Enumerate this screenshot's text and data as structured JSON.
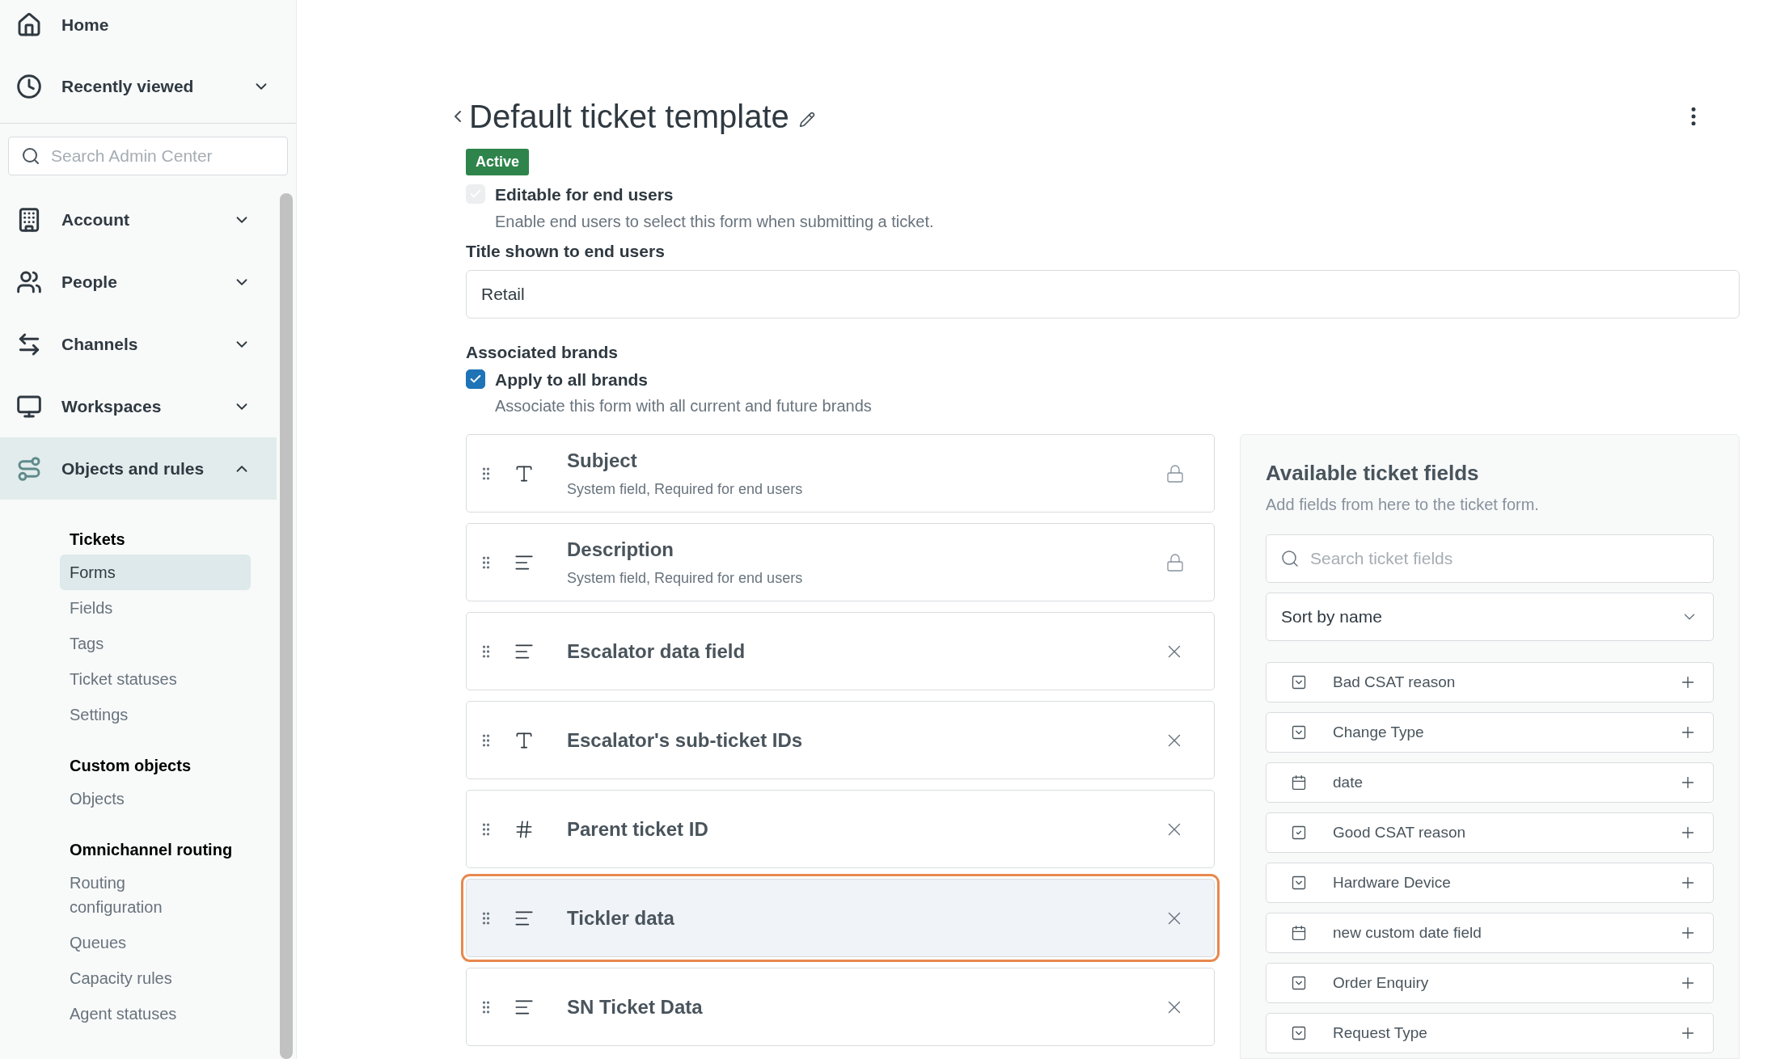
{
  "sidebar": {
    "top_items": [
      {
        "label": "Home",
        "selected": false
      },
      {
        "label": "Recently viewed",
        "selected": false,
        "expanded": false
      }
    ],
    "search": {
      "placeholder": "Search Admin Center"
    },
    "items": [
      {
        "label": "Account",
        "selected": false,
        "expanded": false
      },
      {
        "label": "People",
        "selected": false,
        "expanded": false
      },
      {
        "label": "Channels",
        "selected": false,
        "expanded": false
      },
      {
        "label": "Workspaces",
        "selected": false,
        "expanded": false
      },
      {
        "label": "Objects and rules",
        "selected": true,
        "expanded": true
      }
    ],
    "sections": [
      {
        "heading": "Tickets",
        "links": [
          {
            "label": "Forms",
            "selected": true
          },
          {
            "label": "Fields",
            "selected": false
          },
          {
            "label": "Tags",
            "selected": false
          },
          {
            "label": "Ticket statuses",
            "selected": false
          },
          {
            "label": "Settings",
            "selected": false
          }
        ]
      },
      {
        "heading": "Custom objects",
        "links": [
          {
            "label": "Objects",
            "selected": false
          }
        ]
      },
      {
        "heading": "Omnichannel routing",
        "links": [
          {
            "label": "Routing configuration",
            "selected": false
          },
          {
            "label": "Queues",
            "selected": false
          },
          {
            "label": "Capacity rules",
            "selected": false
          },
          {
            "label": "Agent statuses",
            "selected": false
          }
        ]
      }
    ]
  },
  "header": {
    "title": "Default ticket template",
    "status": "Active"
  },
  "editable": {
    "label": "Editable for end users",
    "hint": "Enable end users to select this form when submitting a ticket.",
    "checked": true,
    "disabled": true
  },
  "title_field": {
    "label": "Title shown to end users",
    "value": "Retail"
  },
  "brands": {
    "heading": "Associated brands",
    "label": "Apply to all brands",
    "hint": "Associate this form with all current and future brands",
    "checked": true,
    "disabled": false
  },
  "form_fields": [
    {
      "name": "Subject",
      "kind": "text",
      "detail": "System field, Required for end users",
      "locked": true,
      "highlighted": false
    },
    {
      "name": "Description",
      "kind": "multiline",
      "detail": "System field, Required for end users",
      "locked": true,
      "highlighted": false
    },
    {
      "name": "Escalator data field",
      "kind": "multiline",
      "locked": false,
      "highlighted": false
    },
    {
      "name": "Escalator's sub-ticket IDs",
      "kind": "text",
      "locked": false,
      "highlighted": false
    },
    {
      "name": "Parent ticket ID",
      "kind": "number",
      "locked": false,
      "highlighted": false
    },
    {
      "name": "Tickler data",
      "kind": "multiline",
      "locked": false,
      "highlighted": true
    },
    {
      "name": "SN Ticket Data",
      "kind": "multiline",
      "locked": false,
      "highlighted": false
    }
  ],
  "available": {
    "title": "Available ticket fields",
    "subtitle": "Add fields from here to the ticket form.",
    "search_placeholder": "Search ticket fields",
    "sort": "Sort by name",
    "fields": [
      {
        "name": "Bad CSAT reason",
        "kind": "dropdown"
      },
      {
        "name": "Change Type",
        "kind": "dropdown"
      },
      {
        "name": "date",
        "kind": "date"
      },
      {
        "name": "Good CSAT reason",
        "kind": "multiselect"
      },
      {
        "name": "Hardware Device",
        "kind": "dropdown"
      },
      {
        "name": "new custom date field",
        "kind": "date"
      },
      {
        "name": "Order Enquiry",
        "kind": "dropdown"
      },
      {
        "name": "Request Type",
        "kind": "dropdown"
      }
    ]
  }
}
